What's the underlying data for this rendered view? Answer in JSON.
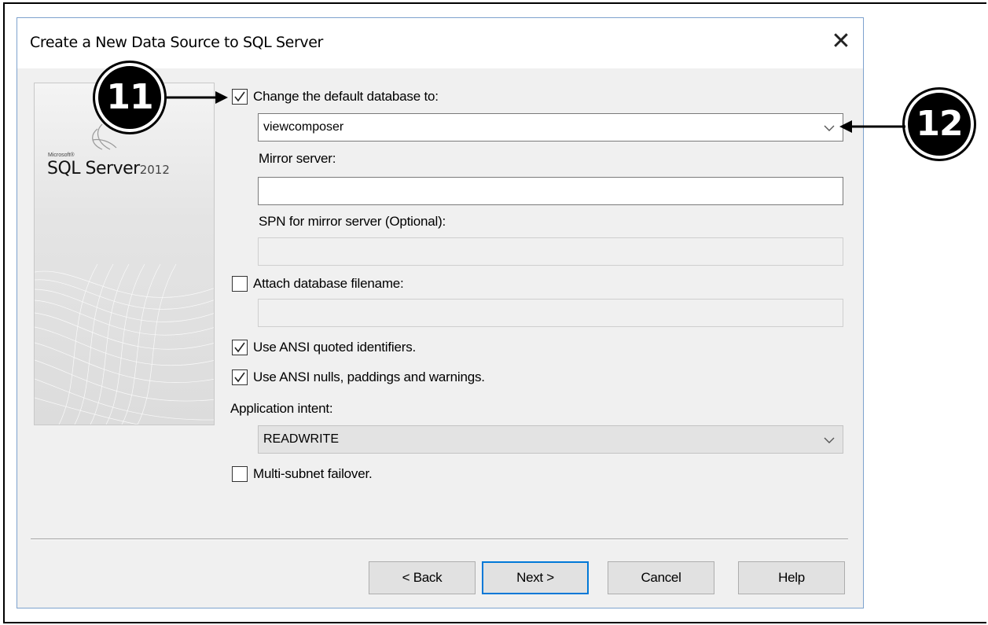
{
  "dialog": {
    "title": "Create a New Data Source to SQL Server",
    "close_glyph": "✕"
  },
  "logo": {
    "brand_small": "Microsoft®",
    "product": "SQL Server",
    "year": "2012"
  },
  "options": {
    "change_default_db": {
      "label": "Change the default database to:",
      "checked": true
    },
    "database": {
      "value": "viewcomposer"
    },
    "mirror_server": {
      "label": "Mirror server:",
      "value": ""
    },
    "spn_mirror": {
      "label": "SPN for mirror server (Optional):",
      "value": ""
    },
    "attach_db": {
      "label": "Attach database filename:",
      "checked": false,
      "value": ""
    },
    "ansi_quoted": {
      "label": "Use ANSI quoted identifiers.",
      "checked": true
    },
    "ansi_nulls": {
      "label": "Use ANSI nulls, paddings and warnings.",
      "checked": true
    },
    "app_intent": {
      "label": "Application intent:",
      "value": "READWRITE"
    },
    "multi_subnet": {
      "label": "Multi-subnet failover.",
      "checked": false
    }
  },
  "buttons": {
    "back": "< Back",
    "next": "Next >",
    "cancel": "Cancel",
    "help": "Help"
  },
  "callouts": {
    "first": "11",
    "second": "12"
  },
  "icons": {
    "check": "checkmark-icon",
    "chevron": "chevron-down-icon",
    "close": "close-icon",
    "arrow": "arrow-icon"
  },
  "colors": {
    "dialog_bg": "#f0f0f0",
    "default_button_border": "#0078d7",
    "window_border": "#7da2ce"
  }
}
